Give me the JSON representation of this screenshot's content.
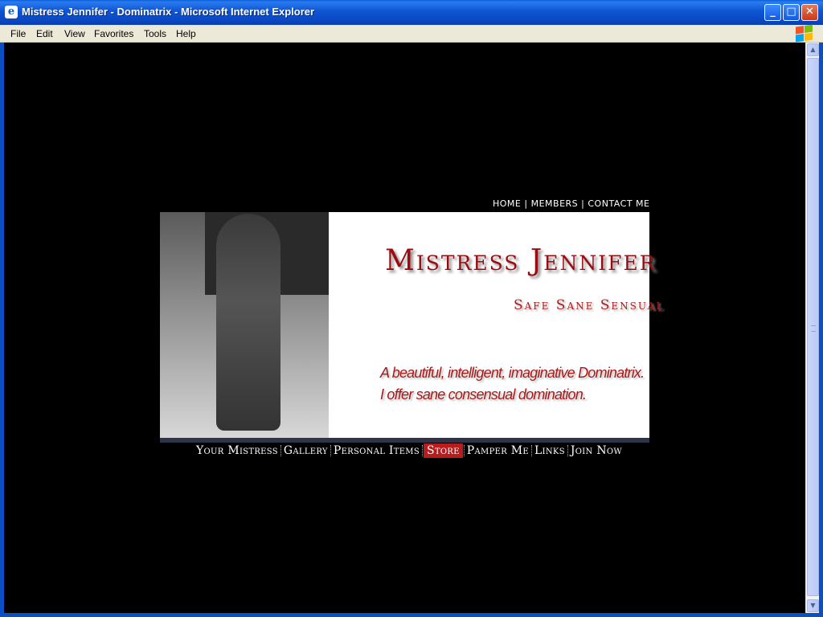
{
  "window": {
    "title": "Mistress Jennifer - Dominatrix - Microsoft Internet Explorer",
    "app_icon": "ie-icon",
    "min_label": "_",
    "max_label": "□",
    "close_label": "✕"
  },
  "menu": {
    "items": [
      {
        "label": "File"
      },
      {
        "label": "Edit"
      },
      {
        "label": "View"
      },
      {
        "label": "Favorites"
      },
      {
        "label": "Tools"
      },
      {
        "label": "Help"
      }
    ]
  },
  "page": {
    "top_nav": {
      "home": "HOME",
      "members": "MEMBERS",
      "contact": "CONTACT ME",
      "separator": "|"
    },
    "banner": {
      "brand": "Mistress Jennifer",
      "tagline": "Safe Sane Sensual",
      "desc_line1": "A beautiful, intelligent, imaginative Dominatrix.",
      "desc_line2": "I offer sane consensual domination."
    },
    "main_nav": [
      {
        "label": "Your Mistress",
        "active": false
      },
      {
        "label": "Gallery",
        "active": false
      },
      {
        "label": "Personal Items",
        "active": false
      },
      {
        "label": "Store",
        "active": true
      },
      {
        "label": "Pamper Me",
        "active": false
      },
      {
        "label": "Links",
        "active": false
      },
      {
        "label": "Join Now",
        "active": false
      }
    ]
  },
  "colors": {
    "brand_red": "#9b0c12",
    "nav_active": "#b81c1c",
    "titlebar_blue": "#0d55d2",
    "page_bg": "#000000"
  }
}
